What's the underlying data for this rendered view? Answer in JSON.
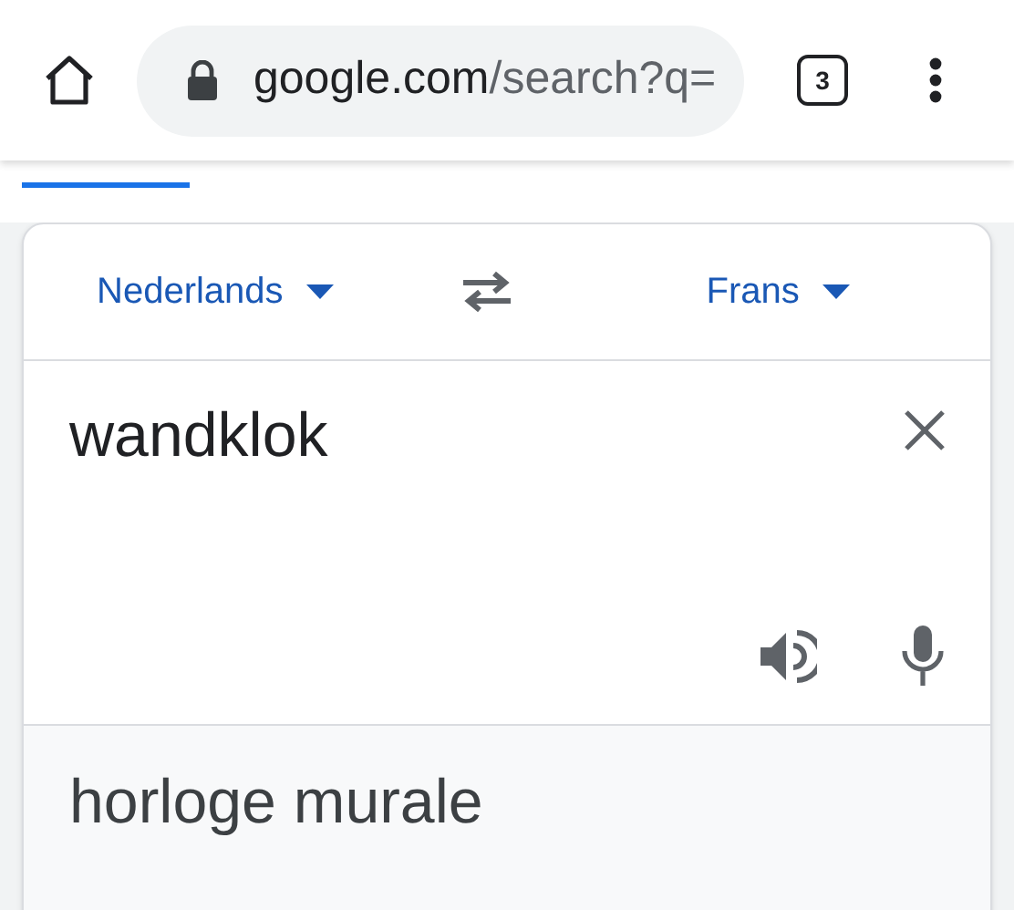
{
  "browser": {
    "url_host": "google.com",
    "url_path": "/search?q=",
    "tab_count": "3"
  },
  "translator": {
    "source_language": "Nederlands",
    "target_language": "Frans",
    "input": "wandklok",
    "output": "horloge murale"
  }
}
